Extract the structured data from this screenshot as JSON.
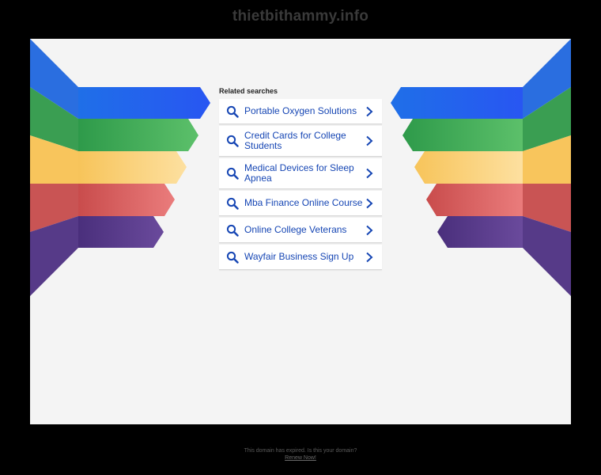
{
  "site": {
    "title": "thietbithammy.info"
  },
  "related": {
    "heading": "Related searches",
    "items": [
      {
        "label": "Portable Oxygen Solutions"
      },
      {
        "label": "Credit Cards for College Students"
      },
      {
        "label": "Medical Devices for Sleep Apnea"
      },
      {
        "label": "Mba Finance Online Course"
      },
      {
        "label": "Online College Veterans"
      },
      {
        "label": "Wayfair Business Sign Up"
      }
    ]
  },
  "footer": {
    "notice": "This domain has expired. Is this your domain?",
    "renew_link": "Renew Now!"
  },
  "colors": {
    "background": "#000000",
    "panel": "#f4f4f4",
    "link": "#1646b4",
    "ribbon_blue": "#2a6cf0",
    "ribbon_green": "#3aa85a",
    "ribbon_yellow": "#fbcd6a",
    "ribbon_red": "#e06a6a",
    "ribbon_purple": "#5b3e8c"
  }
}
